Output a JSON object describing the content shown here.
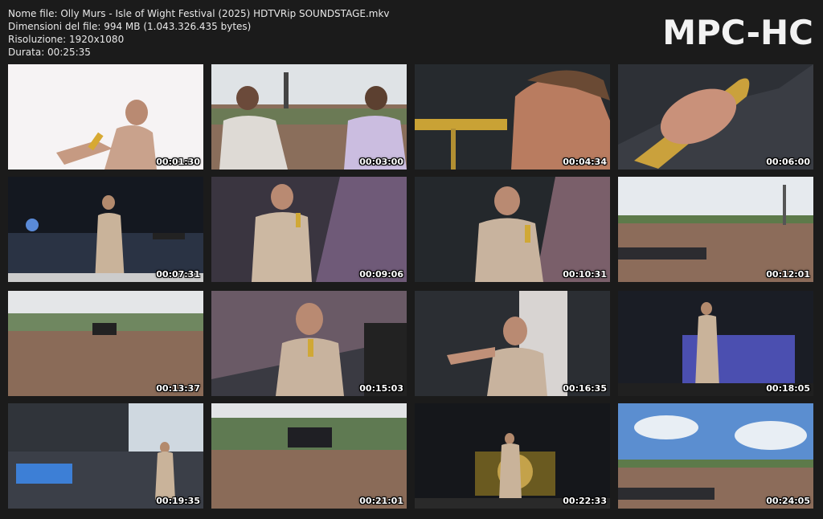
{
  "header": {
    "filename": "Nome file: Olly Murs - Isle of Wight Festival (2025) HDTVRip SOUNDSTAGE.mkv",
    "filesize": "Dimensioni del file: 994 MB (1.043.326.435 bytes)",
    "resolution": "Risoluzione: 1920x1080",
    "duration": "Durata: 00:25:35"
  },
  "logo": "MPC-HC",
  "thumbnails": [
    {
      "time": "00:01:30",
      "scene": "singer-white-bg"
    },
    {
      "time": "00:03:00",
      "scene": "crowd-backs"
    },
    {
      "time": "00:04:34",
      "scene": "closeup-gold-mic"
    },
    {
      "time": "00:06:00",
      "scene": "hand-gold-mic"
    },
    {
      "time": "00:07:31",
      "scene": "stage-confetti"
    },
    {
      "time": "00:09:06",
      "scene": "singer-mic"
    },
    {
      "time": "00:10:31",
      "scene": "singer-hand-chest"
    },
    {
      "time": "00:12:01",
      "scene": "crowd-wide"
    },
    {
      "time": "00:13:37",
      "scene": "crowd-aerial"
    },
    {
      "time": "00:15:03",
      "scene": "singer-mic-close"
    },
    {
      "time": "00:16:35",
      "scene": "singer-pointing"
    },
    {
      "time": "00:18:05",
      "scene": "stage-blue"
    },
    {
      "time": "00:19:35",
      "scene": "stage-band"
    },
    {
      "time": "00:21:01",
      "scene": "crowd-aerial-2"
    },
    {
      "time": "00:22:33",
      "scene": "stage-gold-screen"
    },
    {
      "time": "00:24:05",
      "scene": "crowd-sky"
    }
  ]
}
